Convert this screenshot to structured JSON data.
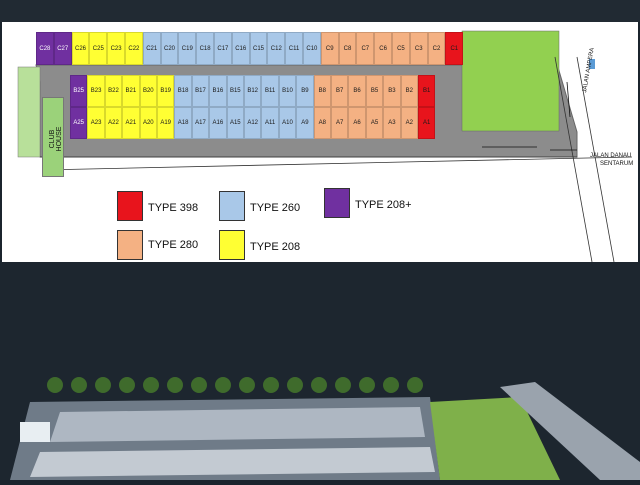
{
  "siteplan": {
    "row_c": [
      "C28",
      "C27",
      "C26",
      "C25",
      "C23",
      "C22",
      "C21",
      "C20",
      "C19",
      "C18",
      "C17",
      "C16",
      "C15",
      "C12",
      "C11",
      "C10",
      "C9",
      "C8",
      "C7",
      "C6",
      "C5",
      "C3",
      "C2",
      "C1"
    ],
    "row_b": [
      "B25",
      "B23",
      "B22",
      "B21",
      "B20",
      "B19",
      "B18",
      "B17",
      "B16",
      "B15",
      "B12",
      "B11",
      "B10",
      "B9",
      "B8",
      "B7",
      "B6",
      "B5",
      "B3",
      "B2",
      "B1"
    ],
    "row_a": [
      "A25",
      "A23",
      "A22",
      "A21",
      "A20",
      "A19",
      "A18",
      "A17",
      "A16",
      "A15",
      "A12",
      "A11",
      "A10",
      "A9",
      "A8",
      "A7",
      "A6",
      "A5",
      "A3",
      "A2",
      "A1"
    ],
    "club_house_label": "CLUB HOUSE",
    "road_label_1": "JALAN AMPERA",
    "road_label_2a": "JALAN DANAU",
    "road_label_2b": "SENTARUM"
  },
  "legend": {
    "items": [
      {
        "label": "TYPE 398",
        "color": "#e8141c"
      },
      {
        "label": "TYPE 260",
        "color": "#a9c8e8"
      },
      {
        "label": "TYPE 208+",
        "color": "#7030a0"
      },
      {
        "label": "TYPE 280",
        "color": "#f4b183"
      },
      {
        "label": "TYPE 208",
        "color": "#ffff33"
      }
    ]
  },
  "colors": {
    "type398": "#e8141c",
    "type260": "#a9c8e8",
    "type208plus": "#7030a0",
    "type280": "#f4b183",
    "type208": "#ffff33",
    "green": "#92d050",
    "road": "#8c8c8c"
  }
}
